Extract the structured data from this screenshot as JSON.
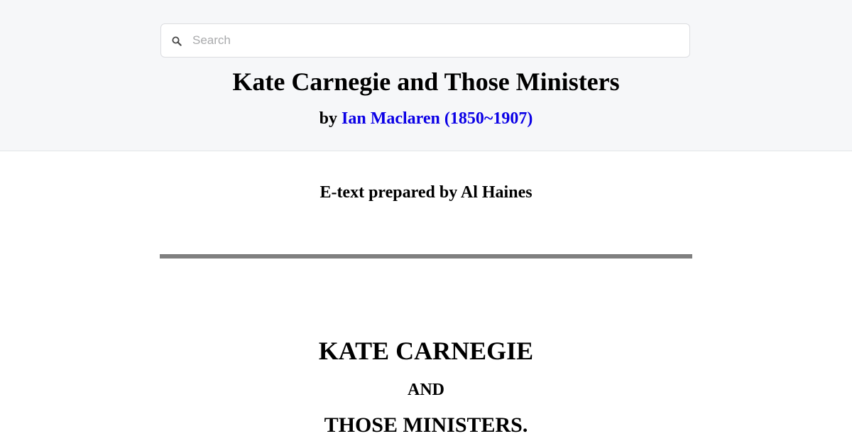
{
  "search": {
    "placeholder": "Search",
    "value": ""
  },
  "book": {
    "title": "Kate Carnegie and Those Ministers",
    "by_prefix": "by ",
    "author": "Ian Maclaren (1850~1907)"
  },
  "credits": {
    "etext": "E-text prepared by Al Haines"
  },
  "content": {
    "heading_main": "KATE CARNEGIE",
    "heading_and": "AND",
    "heading_sub": "THOSE MINISTERS."
  },
  "colors": {
    "header_bg": "#f6f7f9",
    "link": "#0b00e6",
    "rule": "#808080"
  },
  "icons": {
    "search": "search-icon"
  }
}
